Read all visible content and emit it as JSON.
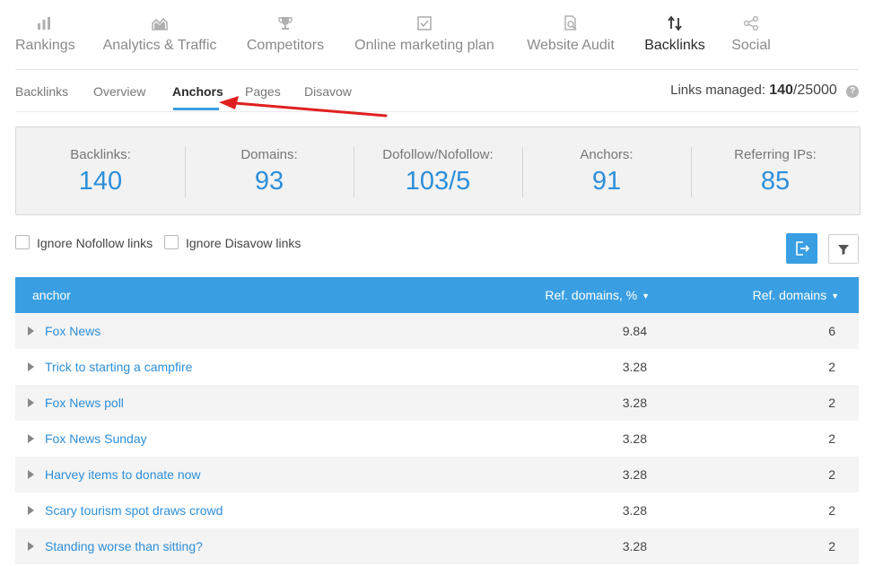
{
  "topnav": {
    "items": [
      {
        "label": "Rankings",
        "icon": "bar-chart-icon",
        "active": false
      },
      {
        "label": "Analytics & Traffic",
        "icon": "area-chart-icon",
        "active": false
      },
      {
        "label": "Competitors",
        "icon": "trophy-icon",
        "active": false
      },
      {
        "label": "Online marketing plan",
        "icon": "checkbox-icon",
        "active": false
      },
      {
        "label": "Website Audit",
        "icon": "document-search-icon",
        "active": false
      },
      {
        "label": "Backlinks",
        "icon": "link-arrows-icon",
        "active": true
      },
      {
        "label": "Social",
        "icon": "share-icon",
        "active": false
      }
    ]
  },
  "subtabs": {
    "items": [
      {
        "label": "Backlinks",
        "active": false
      },
      {
        "label": "Overview",
        "active": false
      },
      {
        "label": "Anchors",
        "active": true
      },
      {
        "label": "Pages",
        "active": false
      },
      {
        "label": "Disavow",
        "active": false
      }
    ],
    "links_managed": {
      "label": "Links managed:",
      "current": "140",
      "limit": "/25000"
    }
  },
  "stats": [
    {
      "label": "Backlinks:",
      "value": "140"
    },
    {
      "label": "Domains:",
      "value": "93"
    },
    {
      "label": "Dofollow/Nofollow:",
      "value": "103/5"
    },
    {
      "label": "Anchors:",
      "value": "91"
    },
    {
      "label": "Referring IPs:",
      "value": "85"
    }
  ],
  "filters": {
    "ignore_nofollow": "Ignore Nofollow links",
    "ignore_disavow": "Ignore Disavow links"
  },
  "colors": {
    "accent": "#3a9fe2",
    "link": "#2d8fd9",
    "annotation_arrow": "#e02020"
  },
  "table": {
    "headers": {
      "anchor": "anchor",
      "ref_pct": "Ref. domains, %",
      "ref": "Ref. domains"
    },
    "rows": [
      {
        "anchor": "Fox News",
        "pct": "9.84",
        "ref": "6"
      },
      {
        "anchor": "Trick to starting a campfire",
        "pct": "3.28",
        "ref": "2"
      },
      {
        "anchor": "Fox News poll",
        "pct": "3.28",
        "ref": "2"
      },
      {
        "anchor": "Fox News Sunday",
        "pct": "3.28",
        "ref": "2"
      },
      {
        "anchor": "Harvey items to donate now",
        "pct": "3.28",
        "ref": "2"
      },
      {
        "anchor": "Scary tourism spot draws crowd",
        "pct": "3.28",
        "ref": "2"
      },
      {
        "anchor": "Standing worse than sitting?",
        "pct": "3.28",
        "ref": "2"
      }
    ]
  }
}
